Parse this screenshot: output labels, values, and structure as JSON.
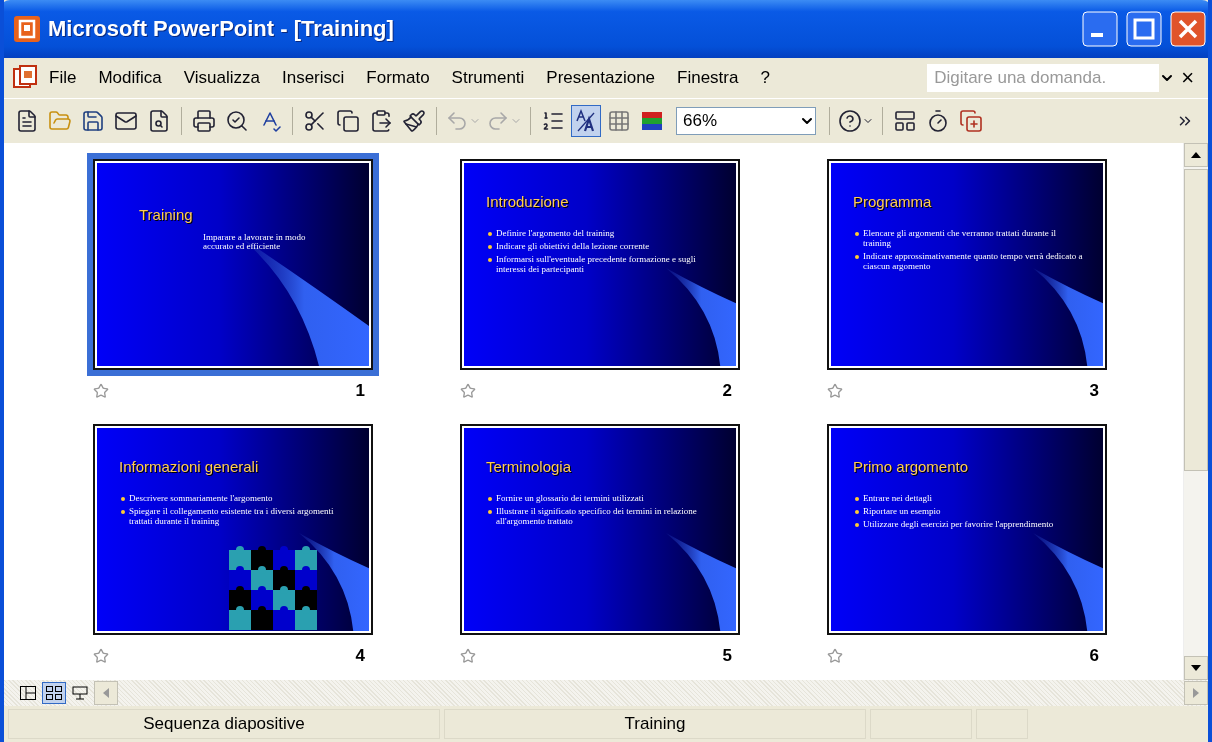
{
  "window": {
    "title": "Microsoft PowerPoint - [Training]"
  },
  "menu": [
    "File",
    "Modifica",
    "Visualizza",
    "Inserisci",
    "Formato",
    "Strumenti",
    "Presentazione",
    "Finestra",
    "?"
  ],
  "help_box": {
    "placeholder": "Digitare una domanda."
  },
  "close_document": "×",
  "toolbar": {
    "undo": {
      "disabled": true
    },
    "redo": {
      "disabled": true
    },
    "show_formatting": {
      "pressed": true
    },
    "zoom": "66%"
  },
  "slides": [
    {
      "number": "1",
      "selected": true,
      "kind": "title",
      "title": "Training",
      "subtitle": "Imparare a lavorare in modo accurato ed efficiente"
    },
    {
      "number": "2",
      "selected": false,
      "kind": "bullets",
      "title": "Introduzione",
      "bullets": [
        "Definire l'argomento del training",
        "Indicare gli obiettivi della lezione corrente",
        "Informarsi sull'eventuale precedente formazione e sugli interessi dei partecipanti"
      ]
    },
    {
      "number": "3",
      "selected": false,
      "kind": "bullets",
      "title": "Programma",
      "bullets": [
        "Elencare gli argomenti che verranno trattati durante il training",
        "Indicare approssimativamente quanto tempo verrà dedicato a ciascun argomento"
      ]
    },
    {
      "number": "4",
      "selected": false,
      "kind": "puzzle",
      "title": "Informazioni generali",
      "bullets": [
        "Descrivere sommariamente l'argomento",
        "Spiegare il collegamento esistente tra i diversi argomenti trattati durante il training"
      ]
    },
    {
      "number": "5",
      "selected": false,
      "kind": "bullets",
      "title": "Terminologia",
      "bullets": [
        "Fornire un glossario dei termini utilizzati",
        "Illustrare il significato specifico dei termini in relazione all'argomento trattato"
      ]
    },
    {
      "number": "6",
      "selected": false,
      "kind": "bullets",
      "title": "Primo argomento",
      "bullets": [
        "Entrare nei dettagli",
        "Riportare un esempio",
        "Utilizzare degli esercizi per favorire l'apprendimento"
      ]
    }
  ],
  "view_buttons": [
    {
      "kind": "normal",
      "selected": false
    },
    {
      "kind": "sorter",
      "selected": true
    },
    {
      "kind": "show",
      "selected": false
    }
  ],
  "status_bar": [
    "Sequenza diapositive",
    "Training"
  ]
}
